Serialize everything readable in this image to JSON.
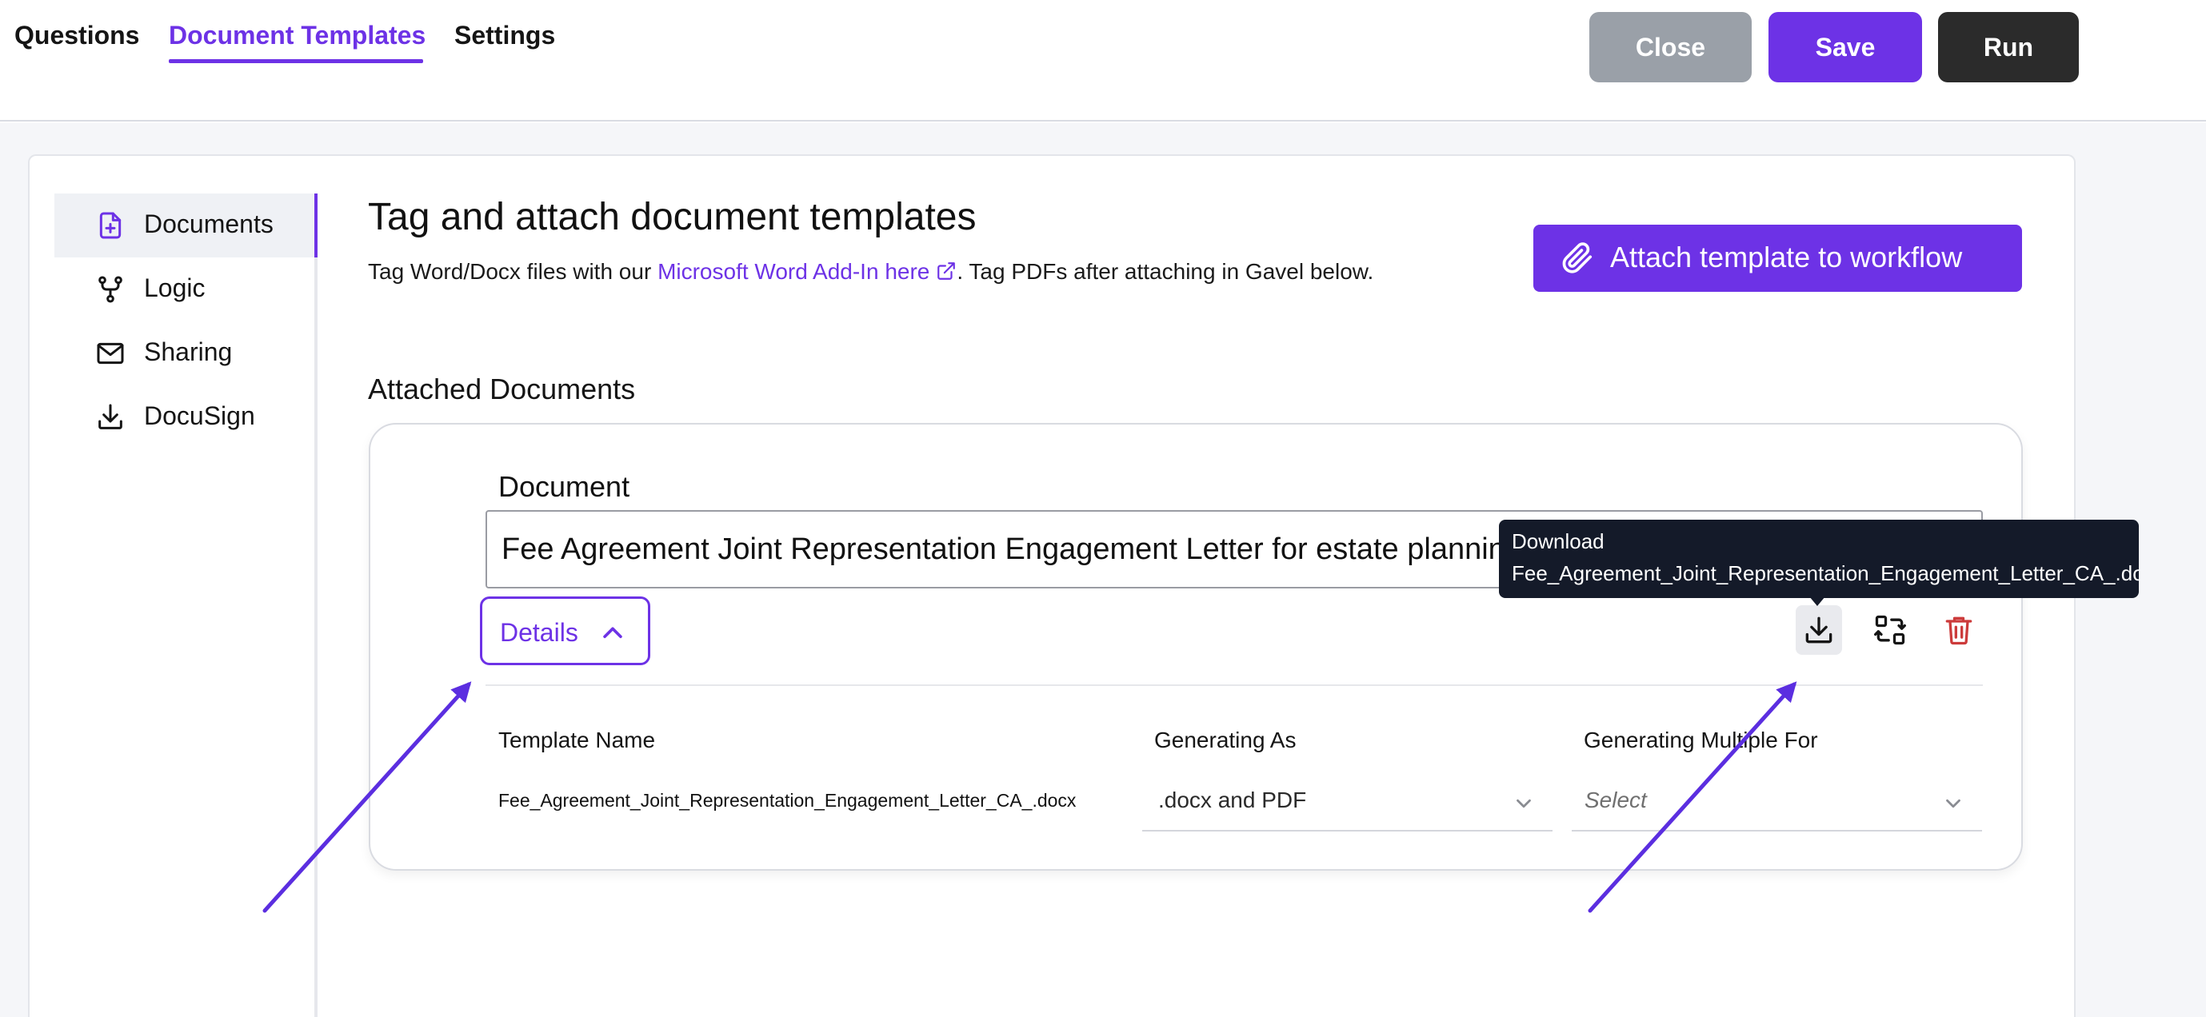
{
  "tabs": [
    {
      "label": "Questions",
      "active": false
    },
    {
      "label": "Document Templates",
      "active": true
    },
    {
      "label": "Settings",
      "active": false
    }
  ],
  "top_actions": {
    "close_label": "Close",
    "save_label": "Save",
    "run_label": "Run"
  },
  "sidebar": {
    "items": [
      {
        "label": "Documents",
        "icon": "document-add-icon",
        "active": true
      },
      {
        "label": "Logic",
        "icon": "branch-icon",
        "active": false
      },
      {
        "label": "Sharing",
        "icon": "envelope-icon",
        "active": false
      },
      {
        "label": "DocuSign",
        "icon": "download-icon",
        "active": false
      }
    ]
  },
  "header": {
    "title": "Tag and attach document templates",
    "subtitle_prefix": "Tag Word/Docx files with our ",
    "subtitle_link": "Microsoft Word Add-In here",
    "subtitle_suffix": ". Tag PDFs after attaching in Gavel below.",
    "attach_button": "Attach template to workflow"
  },
  "attached": {
    "section_title": "Attached Documents",
    "document_label": "Document",
    "document_name": "Fee Agreement Joint Representation Engagement Letter for estate planning",
    "details_label": "Details",
    "columns": {
      "template_name": "Template Name",
      "generating_as": "Generating As",
      "generating_multiple_for": "Generating Multiple For"
    },
    "template_file": "Fee_Agreement_Joint_Representation_Engagement_Letter_CA_.docx",
    "generating_as_value": ".docx and PDF",
    "generating_multiple_placeholder": "Select"
  },
  "tooltip": {
    "line1": "Download",
    "line2": "Fee_Agreement_Joint_Representation_Engagement_Letter_CA_.docx"
  },
  "colors": {
    "accent": "#6d32e6",
    "close_button": "#9aa0a8",
    "run_button": "#2b2b2b",
    "delete": "#cc3b3b",
    "tooltip_bg": "#141a29"
  }
}
